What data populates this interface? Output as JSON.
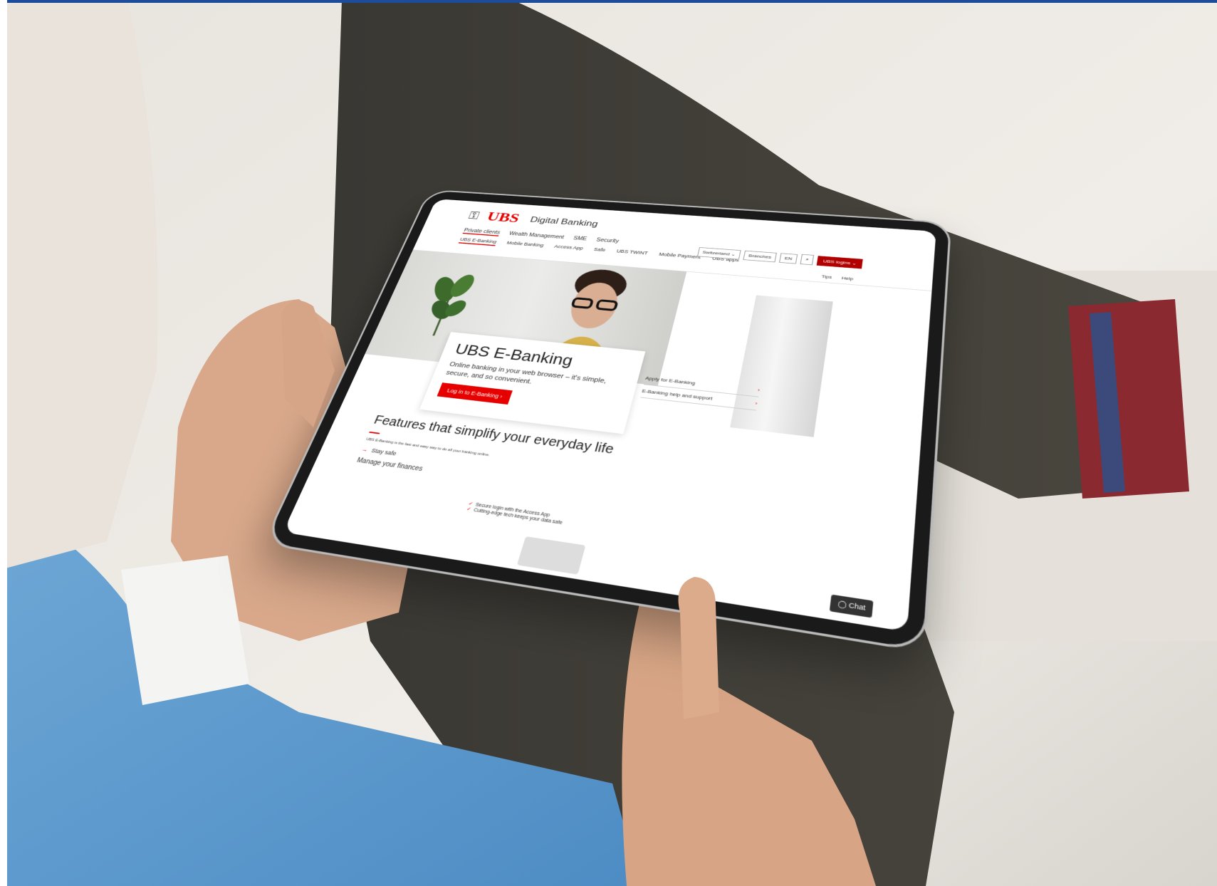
{
  "page": {
    "brand_name": "UBS",
    "brand_sub": "Digital Banking",
    "accent_color": "#e60000"
  },
  "nav_primary": [
    "Private clients",
    "Wealth Management",
    "SME",
    "Security"
  ],
  "nav_secondary": [
    "UBS E-Banking",
    "Mobile Banking",
    "Access App",
    "Safe",
    "UBS TWINT",
    "Mobile Payment",
    "UBS apps"
  ],
  "utility": {
    "country": "Switzerland",
    "branches": "Branches",
    "language": "EN",
    "login": "UBS logins"
  },
  "help_links": [
    "Tips",
    "Help"
  ],
  "hero": {
    "title": "UBS E-Banking",
    "text": "Online banking in your web browser – it's simple, secure, and so convenient.",
    "cta": "Log in to E-Banking"
  },
  "side_links": [
    "Apply for E-Banking",
    "E-Banking help and support"
  ],
  "features": {
    "title": "Features that simplify your everyday life",
    "intro": "UBS E-Banking is the fast and easy way to do all your banking online.",
    "tab": "Stay safe",
    "subheading": "Manage your finances",
    "checks": [
      "Secure login with the Access App",
      "Cutting-edge tech keeps your data safe"
    ]
  },
  "chat_label": "Chat"
}
